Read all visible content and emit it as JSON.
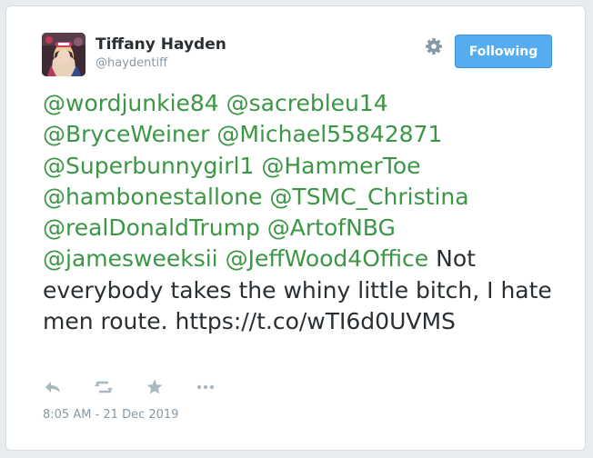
{
  "user": {
    "name": "Tiffany Hayden",
    "handle": "@haydentiff",
    "follow_label": "Following"
  },
  "tweet": {
    "mentions": [
      "@wordjunkie84",
      "@sacrebleu14",
      "@BryceWeiner",
      "@Michael55842871",
      "@Superbunnygirl1",
      "@HammerToe",
      "@hambonestallone",
      "@TSMC_Christina",
      "@realDonaldTrump",
      "@ArtofNBG",
      "@jamesweeksii",
      "@JeffWood4Office"
    ],
    "body": "Not everybody takes the whiny little bitch, I hate men route.",
    "link": "https://t.co/wTI6d0UVMS",
    "timestamp": "8:05 AM - 21 Dec 2019"
  },
  "icons": {
    "settings": "gear-icon",
    "reply": "reply-icon",
    "retweet": "retweet-icon",
    "favorite": "star-icon",
    "more": "more-icon"
  },
  "colors": {
    "mention": "#3b9645",
    "button": "#55acee",
    "muted": "#8899a6",
    "text": "#292f33"
  }
}
